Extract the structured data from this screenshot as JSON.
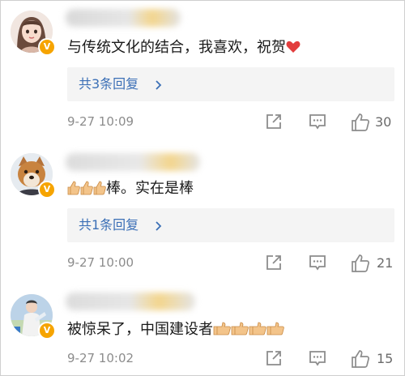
{
  "comments": [
    {
      "avatar": "avatar-girl-cartoon",
      "badge": "V",
      "text": "与传统文化的结合，我喜欢，祝贺",
      "text_suffix_emoji": "red-heart",
      "reply_label": "共3条回复",
      "timestamp": "9-27 10:09",
      "likes": "30"
    },
    {
      "avatar": "avatar-shiba-dog",
      "badge": "V",
      "text_prefix_emoji": "thumbs-up x3",
      "text": "棒。实在是棒",
      "reply_label": "共1条回复",
      "timestamp": "9-27 10:00",
      "likes": "21"
    },
    {
      "avatar": "avatar-person-outdoor",
      "badge": "V",
      "text": "被惊呆了，中国建设者",
      "text_suffix_emoji": "thumbs-up x4",
      "timestamp": "9-27 10:02",
      "likes": "15"
    }
  ],
  "icons": {
    "share": "share-icon",
    "comment": "comment-icon",
    "like": "thumbs-up-icon",
    "reply_more": "chevron-right-icon"
  },
  "colors": {
    "link": "#3b6fb6",
    "badge": "#f6a400",
    "meta": "#8c8c8c",
    "reply_bg": "#f4f4f4"
  }
}
